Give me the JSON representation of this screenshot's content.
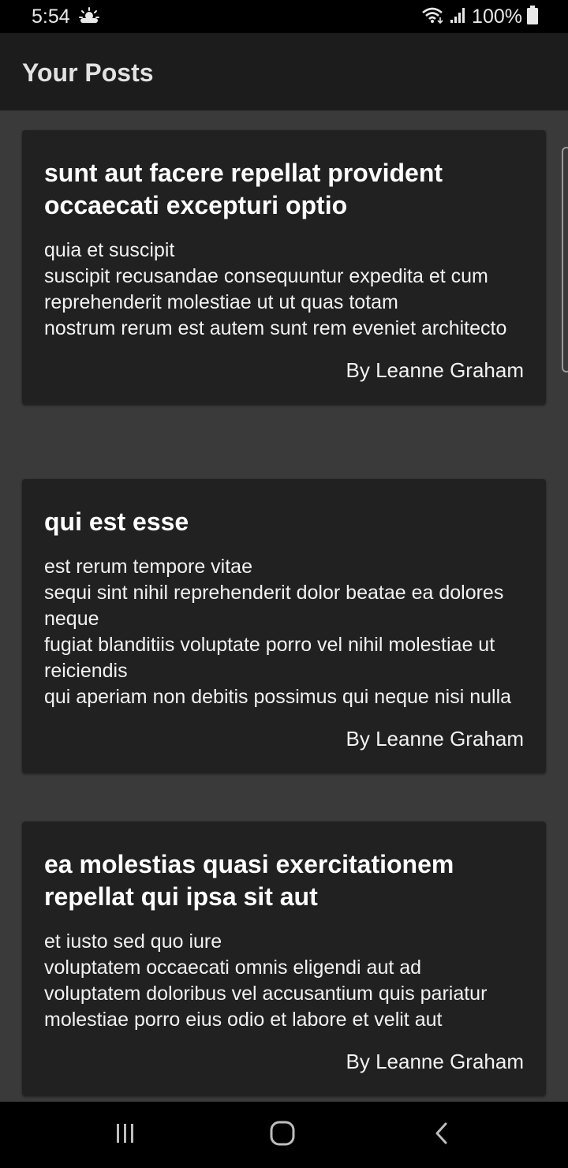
{
  "status_bar": {
    "time": "5:54",
    "weather_icon": "sun-cloud-icon",
    "battery": "100%"
  },
  "app_bar": {
    "title": "Your Posts"
  },
  "posts": [
    {
      "title": "sunt aut facere repellat provident occaecati excepturi optio",
      "body": "quia et suscipit\nsuscipit recusandae consequuntur expedita et cum\nreprehenderit molestiae ut ut quas totam\nnostrum rerum est autem sunt rem eveniet architecto",
      "author": "By Leanne Graham"
    },
    {
      "title": "qui est esse",
      "body": "est rerum tempore vitae\nsequi sint nihil reprehenderit dolor beatae ea dolores neque\nfugiat blanditiis voluptate porro vel nihil molestiae ut reiciendis\nqui aperiam non debitis possimus qui neque nisi nulla",
      "author": "By Leanne Graham"
    },
    {
      "title": "ea molestias quasi exercitationem repellat qui ipsa sit aut",
      "body": "et iusto sed quo iure\nvoluptatem occaecati omnis eligendi aut ad\nvoluptatem doloribus vel accusantium quis pariatur\nmolestiae porro eius odio et labore et velit aut",
      "author": "By Leanne Graham"
    }
  ],
  "nav_bar": {
    "recents_icon": "recents-icon",
    "home_icon": "home-icon",
    "back_icon": "back-icon"
  },
  "colors": {
    "background": "#3a3a3a",
    "app_bar": "#1c1c1c",
    "card": "#212121",
    "text": "#ffffff"
  }
}
